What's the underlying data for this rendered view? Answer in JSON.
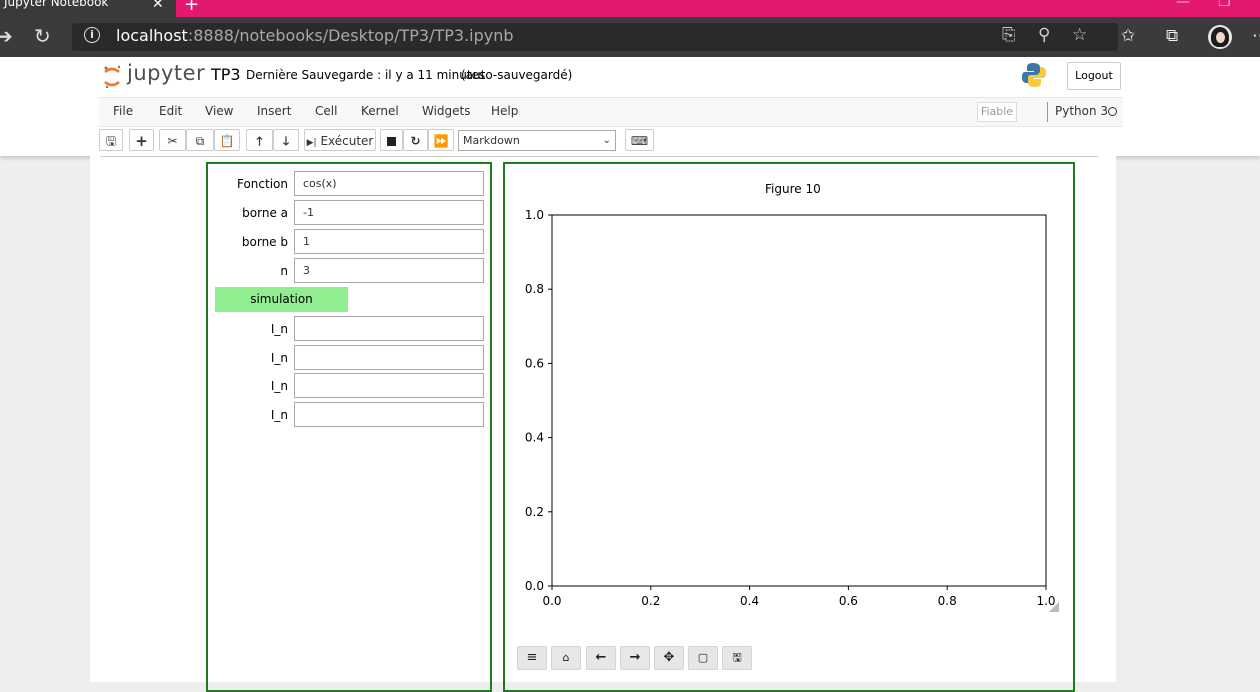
{
  "browser": {
    "tab_title": "Jupyter Notebook",
    "url_host": "localhost",
    "url_path": ":8888/notebooks/Desktop/TP3/TP3.ipynb"
  },
  "header": {
    "logo_text": "jupyter",
    "notebook_name": "TP3",
    "checkpoint": "Dernière Sauvegarde : il y a 11 minutes",
    "autosave": "(auto-sauvegardé)",
    "logout_label": "Logout"
  },
  "menu": {
    "items": [
      "File",
      "Edit",
      "View",
      "Insert",
      "Cell",
      "Kernel",
      "Widgets",
      "Help"
    ],
    "trusted": "Fiable",
    "kernel_name": "Python 3"
  },
  "toolbar": {
    "run_label": "Exécuter",
    "cell_type": "Markdown"
  },
  "widgets": {
    "fields": [
      {
        "label": "Fonction",
        "value": "cos(x)"
      },
      {
        "label": "borne a",
        "value": "-1"
      },
      {
        "label": "borne b",
        "value": "1"
      },
      {
        "label": "n",
        "value": "3"
      }
    ],
    "button_label": "simulation",
    "outputs": [
      {
        "label": "I_n",
        "value": ""
      },
      {
        "label": "I_n",
        "value": ""
      },
      {
        "label": "I_n",
        "value": ""
      },
      {
        "label": "I_n",
        "value": ""
      }
    ]
  },
  "figure": {
    "title": "Figure 10",
    "tools": [
      "menu-icon",
      "home-icon",
      "back-icon",
      "forward-icon",
      "pan-icon",
      "zoom-rect-icon",
      "save-icon"
    ]
  },
  "chart_data": {
    "type": "line",
    "title": "",
    "xlabel": "",
    "ylabel": "",
    "xlim": [
      0.0,
      1.0
    ],
    "ylim": [
      0.0,
      1.0
    ],
    "x_ticks": [
      "0.0",
      "0.2",
      "0.4",
      "0.6",
      "0.8",
      "1.0"
    ],
    "y_ticks": [
      "0.0",
      "0.2",
      "0.4",
      "0.6",
      "0.8",
      "1.0"
    ],
    "series": [],
    "grid": false
  },
  "colors": {
    "tab_bar": "#e3186f",
    "widget_border": "#1d7d1d",
    "sim_button": "#90ee90"
  }
}
